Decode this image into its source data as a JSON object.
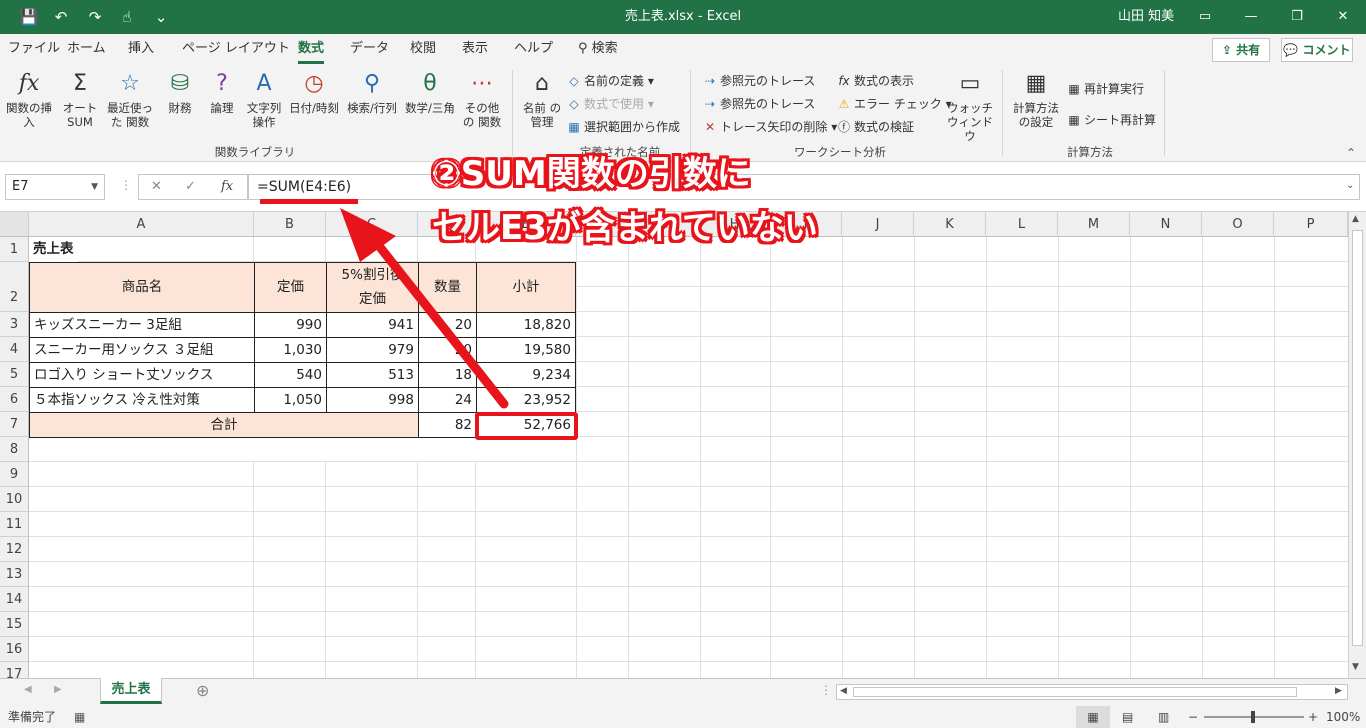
{
  "titlebar": {
    "title": "売上表.xlsx  -  Excel",
    "user": "山田 知美"
  },
  "menu": {
    "tabs": [
      "ファイル",
      "ホーム",
      "挿入",
      "ページ レイアウト",
      "数式",
      "データ",
      "校閲",
      "表示",
      "ヘルプ",
      "検索"
    ],
    "active": "数式",
    "share": "共有",
    "comment": "コメント"
  },
  "ribbon": {
    "big_buttons": [
      "関数の挿入",
      "オート SUM",
      "最近使った 関数",
      "財務",
      "論理",
      "文字列 操作",
      "日付/時刻",
      "検索/行列",
      "数学/三角",
      "その他の 関数",
      "名前 の管理",
      "ウォッチ ウィンドウ",
      "計算方法 の設定"
    ],
    "names_group": [
      "名前の定義",
      "数式で使用",
      "選択範囲から作成"
    ],
    "audit_group": [
      "参照元のトレース",
      "参照先のトレース",
      "トレース矢印の削除",
      "数式の表示",
      "エラー チェック",
      "数式の検証"
    ],
    "calc_group": [
      "再計算実行",
      "シート再計算"
    ],
    "groups": [
      "関数ライブラリ",
      "定義された名前",
      "ワークシート分析",
      "計算方法"
    ]
  },
  "formula_bar": {
    "name_box": "E7",
    "formula": "=SUM(E4:E6)"
  },
  "columns": [
    "A",
    "B",
    "C",
    "D",
    "E",
    "F",
    "G",
    "H",
    "I",
    "J",
    "K",
    "L",
    "M",
    "N",
    "O",
    "P"
  ],
  "rows": [
    "1",
    "2",
    "3",
    "4",
    "5",
    "6",
    "7",
    "8",
    "9",
    "10",
    "11",
    "12",
    "13",
    "14",
    "15",
    "16",
    "17"
  ],
  "table": {
    "title": "売上表",
    "headers": [
      "商品名",
      "定価",
      "5%割引後 定価",
      "数量",
      "小計"
    ],
    "data": [
      [
        "キッズスニーカー 3足組",
        "990",
        "941",
        "20",
        "18,820"
      ],
      [
        "スニーカー用ソックス ３足組",
        "1,030",
        "979",
        "20",
        "19,580"
      ],
      [
        "ロゴ入り ショート丈ソックス",
        "540",
        "513",
        "18",
        "9,234"
      ],
      [
        "５本指ソックス 冷え性対策",
        "1,050",
        "998",
        "24",
        "23,952"
      ]
    ],
    "total_label": "合計",
    "total_qty": "82",
    "total_sum": "52,766"
  },
  "sheet": {
    "tab": "売上表"
  },
  "status": {
    "ready": "準備完了",
    "zoom": "100%"
  },
  "annotation": {
    "line1": "②SUM関数の引数に",
    "line2": "セルE3が含まれていない"
  },
  "colors": {
    "excel_green": "#217346",
    "annotation_red": "#e8141b",
    "header_fill": "#fce4d6"
  }
}
